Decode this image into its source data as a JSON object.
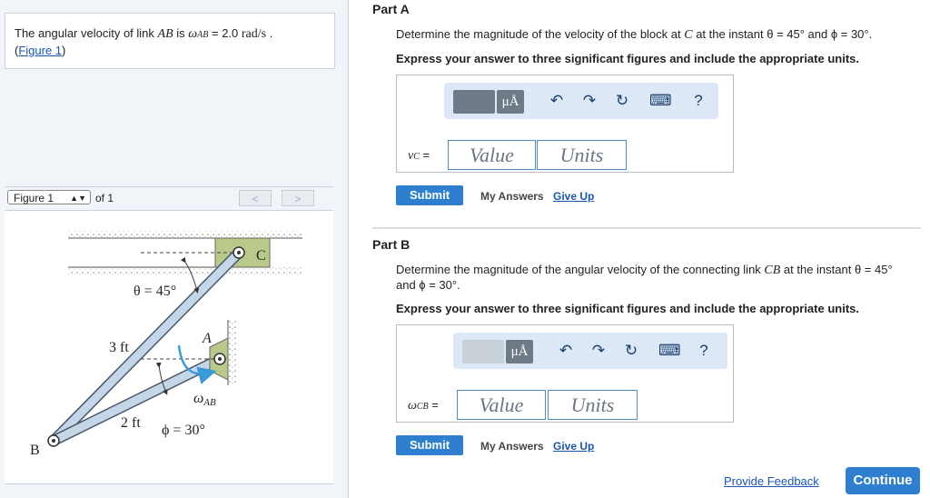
{
  "problem": {
    "pre_text": "The angular velocity of link ",
    "link_symbol": "AB",
    "mid_text": " is ",
    "omega_symbol": "ω",
    "omega_sub": "AB",
    "eq_value": " = 2.0 ",
    "units_text": "rad/s",
    "period": " .",
    "figure_link": "Figure 1"
  },
  "figure_nav": {
    "selected": "Figure 1",
    "of_text": "of 1",
    "prev_symbol": "<",
    "next_symbol": ">"
  },
  "figure": {
    "label_C": "C",
    "label_A": "A",
    "label_B": "B",
    "theta_label": "θ = 45°",
    "len_3": "3 ft",
    "len_2": "2 ft",
    "omega_label": "ω",
    "omega_sub": "AB",
    "phi_label": "ϕ = 30°"
  },
  "part_a": {
    "title": "Part A",
    "q_pre": "Determine the magnitude of the velocity of the block at ",
    "q_sym": "C",
    "q_post": " at the instant θ = 45° and ϕ = 30°.",
    "instruction": "Express your answer to three significant figures and include the appropriate units.",
    "label_sym": "v",
    "label_sub": "C",
    "label_eq": " =",
    "value_placeholder": "Value",
    "units_placeholder": "Units",
    "submit": "Submit",
    "my_answers": "My Answers",
    "give_up": "Give Up"
  },
  "part_b": {
    "title": "Part B",
    "q_pre": "Determine the magnitude of the angular velocity of the connecting link ",
    "q_sym": "CB",
    "q_post": " at the instant θ = 45°",
    "q_line2": "and ϕ = 30°.",
    "instruction": "Express your answer to three significant figures and include the appropriate units.",
    "label_sym": "ω",
    "label_sub": "CB",
    "label_eq": " =",
    "value_placeholder": "Value",
    "units_placeholder": "Units",
    "submit": "Submit",
    "my_answers": "My Answers",
    "give_up": "Give Up"
  },
  "toolbar": {
    "units_glyph": "μÅ",
    "undo_glyph": "↶",
    "redo_glyph": "↷",
    "reset_glyph": "↻",
    "keyboard_glyph": "⌨",
    "help_glyph": "?"
  },
  "footer": {
    "feedback": "Provide Feedback",
    "continue": "Continue"
  },
  "colors": {
    "accent": "#2f7fd0",
    "link": "#1a56b0",
    "link_member": "#c5d6e8"
  }
}
